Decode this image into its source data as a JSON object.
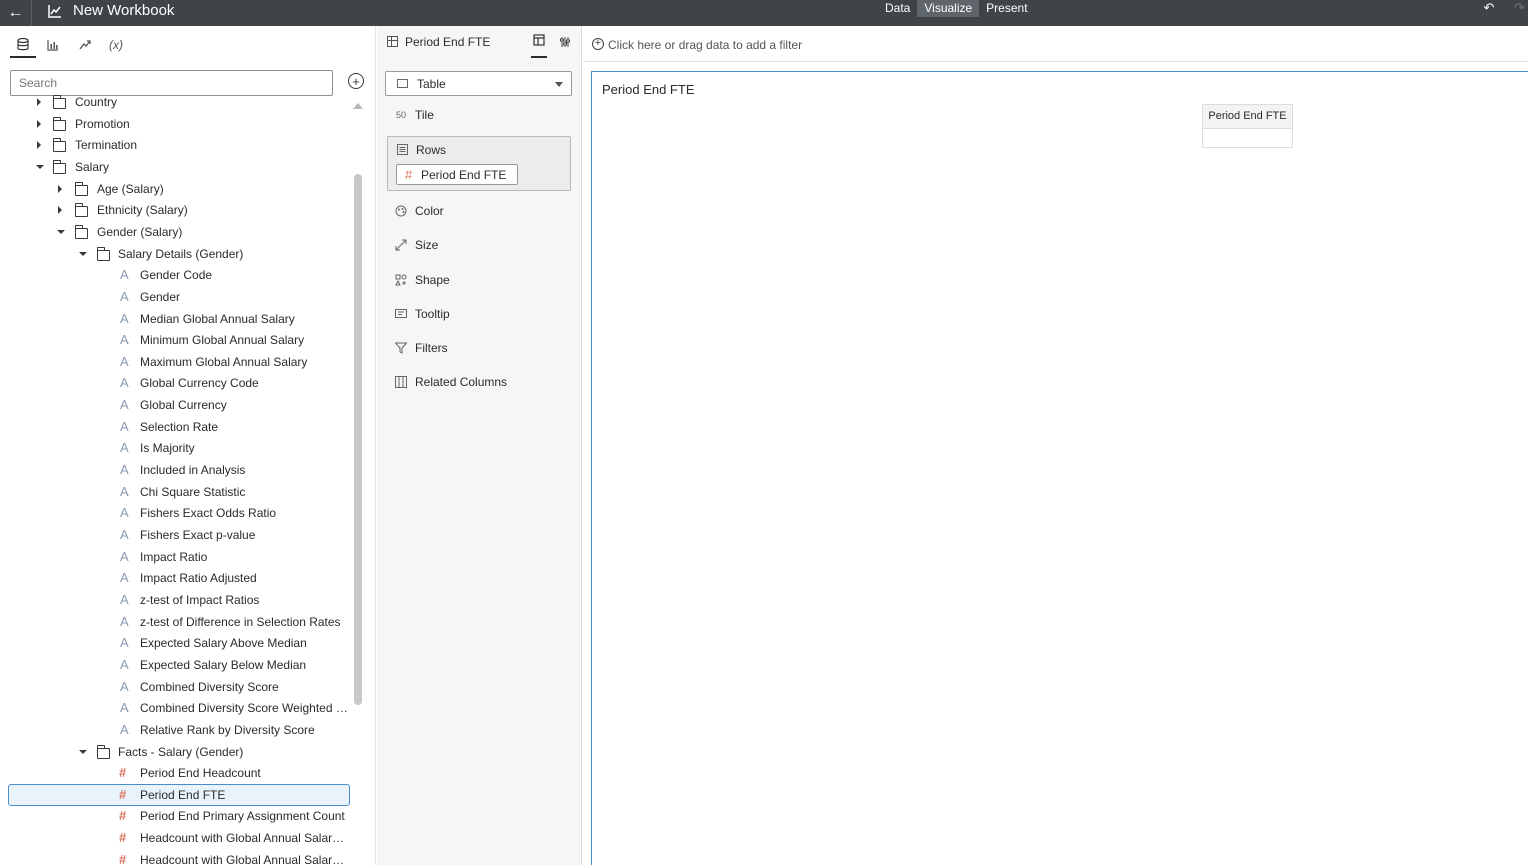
{
  "topbar": {
    "title": "New Workbook",
    "tabs": [
      {
        "label": "Data",
        "active": false
      },
      {
        "label": "Visualize",
        "active": true
      },
      {
        "label": "Present",
        "active": false
      }
    ],
    "back_icon": "back-arrow-icon",
    "undo_icon": "undo-icon",
    "redo_icon": "redo-icon"
  },
  "left_panel": {
    "tabs": [
      "data-icon",
      "visualizations-icon",
      "analytics-icon",
      "calculations-icon"
    ],
    "calc_tab_label": "(x)",
    "search": {
      "placeholder": "Search",
      "value": ""
    },
    "tree": [
      {
        "label": "Country",
        "type": "folder",
        "level": 0,
        "expanded": false
      },
      {
        "label": "Promotion",
        "type": "folder",
        "level": 0,
        "expanded": false
      },
      {
        "label": "Termination",
        "type": "folder",
        "level": 0,
        "expanded": false
      },
      {
        "label": "Salary",
        "type": "folder",
        "level": 0,
        "expanded": true
      },
      {
        "label": "Age (Salary)",
        "type": "folder",
        "level": 1,
        "expanded": false
      },
      {
        "label": "Ethnicity (Salary)",
        "type": "folder",
        "level": 1,
        "expanded": false
      },
      {
        "label": "Gender (Salary)",
        "type": "folder",
        "level": 1,
        "expanded": true
      },
      {
        "label": "Salary Details (Gender)",
        "type": "folder",
        "level": 2,
        "expanded": true
      },
      {
        "label": "Gender Code",
        "type": "attribute",
        "level": 3
      },
      {
        "label": "Gender",
        "type": "attribute",
        "level": 3
      },
      {
        "label": "Median Global Annual Salary",
        "type": "attribute",
        "level": 3
      },
      {
        "label": "Minimum Global Annual Salary",
        "type": "attribute",
        "level": 3
      },
      {
        "label": "Maximum Global Annual Salary",
        "type": "attribute",
        "level": 3
      },
      {
        "label": "Global Currency Code",
        "type": "attribute",
        "level": 3
      },
      {
        "label": "Global Currency",
        "type": "attribute",
        "level": 3
      },
      {
        "label": "Selection Rate",
        "type": "attribute",
        "level": 3
      },
      {
        "label": "Is Majority",
        "type": "attribute",
        "level": 3
      },
      {
        "label": "Included in Analysis",
        "type": "attribute",
        "level": 3
      },
      {
        "label": "Chi Square Statistic",
        "type": "attribute",
        "level": 3
      },
      {
        "label": "Fishers Exact Odds Ratio",
        "type": "attribute",
        "level": 3
      },
      {
        "label": "Fishers Exact p-value",
        "type": "attribute",
        "level": 3
      },
      {
        "label": "Impact Ratio",
        "type": "attribute",
        "level": 3
      },
      {
        "label": "Impact Ratio Adjusted",
        "type": "attribute",
        "level": 3
      },
      {
        "label": "z-test of Impact Ratios",
        "type": "attribute",
        "level": 3
      },
      {
        "label": "z-test of Difference in Selection Rates",
        "type": "attribute",
        "level": 3
      },
      {
        "label": "Expected Salary Above Median",
        "type": "attribute",
        "level": 3
      },
      {
        "label": "Expected Salary Below Median",
        "type": "attribute",
        "level": 3
      },
      {
        "label": "Combined Diversity Score",
        "type": "attribute",
        "level": 3
      },
      {
        "label": "Combined Diversity Score Weighted by ...",
        "type": "attribute",
        "level": 3
      },
      {
        "label": "Relative Rank by Diversity Score",
        "type": "attribute",
        "level": 3
      },
      {
        "label": "Facts - Salary (Gender)",
        "type": "folder",
        "level": 2,
        "expanded": true
      },
      {
        "label": "Period End Headcount",
        "type": "measure",
        "level": 3
      },
      {
        "label": "Period End FTE",
        "type": "measure",
        "level": 3,
        "selected": true
      },
      {
        "label": "Period End Primary Assignment Count",
        "type": "measure",
        "level": 3
      },
      {
        "label": "Headcount with Global Annual Salary a...",
        "type": "measure",
        "level": 3
      },
      {
        "label": "Headcount with Global Annual Salary b...",
        "type": "measure",
        "level": 3
      }
    ]
  },
  "grammar_panel": {
    "title": "Period End FTE",
    "viz_type": "Table",
    "items": [
      {
        "label": "Tile",
        "icon": "tile-icon",
        "icon_text": "50"
      },
      {
        "label": "Rows",
        "icon": "rows-icon"
      },
      {
        "label": "Color",
        "icon": "palette-icon"
      },
      {
        "label": "Size",
        "icon": "size-icon"
      },
      {
        "label": "Shape",
        "icon": "shape-icon"
      },
      {
        "label": "Tooltip",
        "icon": "tooltip-icon"
      },
      {
        "label": "Filters",
        "icon": "filter-icon"
      },
      {
        "label": "Related Columns",
        "icon": "columns-icon"
      }
    ],
    "rows_pill": "Period End FTE"
  },
  "filter_bar": {
    "text": "Click here or drag data to add a filter"
  },
  "canvas": {
    "title": "Period End FTE",
    "table_header": "Period End FTE",
    "table_value": ""
  }
}
